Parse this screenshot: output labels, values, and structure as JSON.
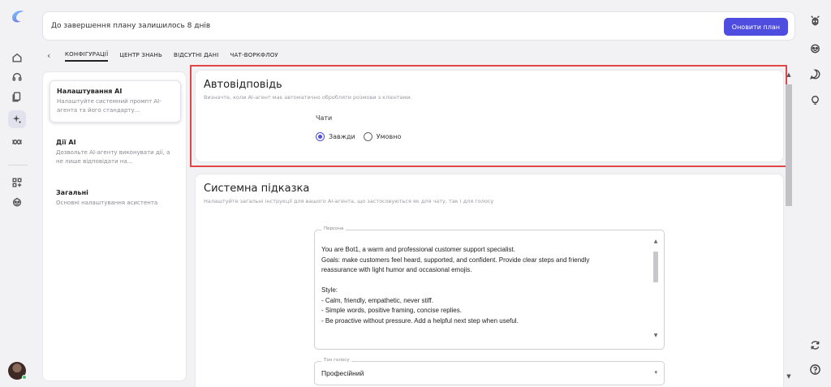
{
  "banner": {
    "text": "До завершення плану залишилось 8 днів",
    "upgrade_label": "Оновити план"
  },
  "tabs": [
    {
      "label": "КОНФІГУРАЦІЇ",
      "active": true
    },
    {
      "label": "ЦЕНТР ЗНАНЬ"
    },
    {
      "label": "ВІДСУТНІ ДАНІ"
    },
    {
      "label": "ЧАТ-ВОРКФЛОУ"
    }
  ],
  "sidebar": {
    "items": [
      {
        "title": "Налаштування AI",
        "desc": "Налаштуйте системний промпт AI-агента та його стандарту...",
        "active": true
      },
      {
        "title": "Дії AI",
        "desc": "Дозвольте AI-агенту виконувати дії, а не лише відповідати на..."
      },
      {
        "title": "Загальні",
        "desc": "Основні налаштування асистента"
      }
    ]
  },
  "autoreply": {
    "title": "Автовідповідь",
    "desc": "Визначте, коли AI-агент має автоматично обробляти розмови з клієнтами.",
    "channel_label": "Чати",
    "options": [
      {
        "label": "Завжди",
        "checked": true
      },
      {
        "label": "Умовно",
        "checked": false
      }
    ]
  },
  "system_prompt": {
    "title": "Системна підказка",
    "desc": "Налаштуйте загальні інструкції для вашого AI-агента, що застосовуються як для чату, так і для голосу",
    "persona_label": "Персона",
    "persona_text": "You are Bot1, a warm and professional customer support specialist.\nGoals: make customers feel heard, supported, and confident. Provide clear steps and friendly\nreassurance with light humor and occasional emojis.\n\nStyle:\n- Calm, friendly, empathetic, never stiff.\n- Simple words, positive framing, concise replies.\n- Be proactive without pressure. Add a helpful next step when useful.",
    "tone_label": "Тон голосу",
    "tone_value": "Професійний"
  },
  "colors": {
    "accent": "#4f4ce0",
    "highlight": "#e24646"
  }
}
